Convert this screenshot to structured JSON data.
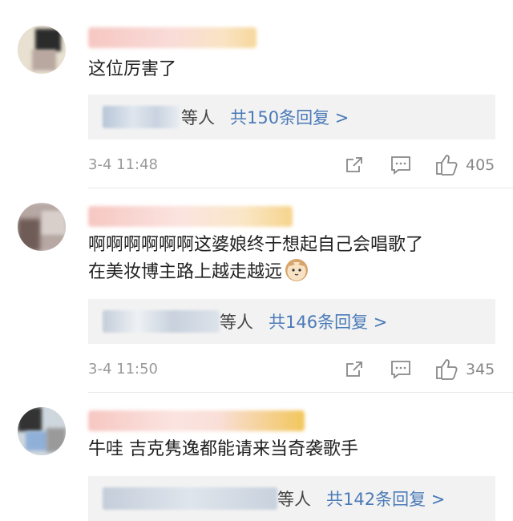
{
  "comments": [
    {
      "text_lines": [
        "这位厉害了"
      ],
      "reply_who": "等人",
      "reply_count": "共150条回复 >",
      "time": "3-4 11:48",
      "likes": "405"
    },
    {
      "text_lines": [
        "啊啊啊啊啊啊这婆娘终于想起自己会唱歌了",
        "在美妆博主路上越走越远"
      ],
      "reply_who": "等人",
      "reply_count": "共146条回复 >",
      "time": "3-4 11:50",
      "likes": "345"
    },
    {
      "text_lines": [
        "牛哇 吉克隽逸都能请来当奇袭歌手"
      ],
      "reply_who": "等人",
      "reply_count": "共142条回复 >"
    }
  ],
  "icons": {
    "share": "share-icon",
    "comment": "comment-icon",
    "like": "thumbs-up-icon",
    "emoji": "cat-emoji-icon"
  },
  "colors": {
    "link": "#4a7ab8",
    "meta": "#999999",
    "reply_bg": "#f2f2f2"
  }
}
